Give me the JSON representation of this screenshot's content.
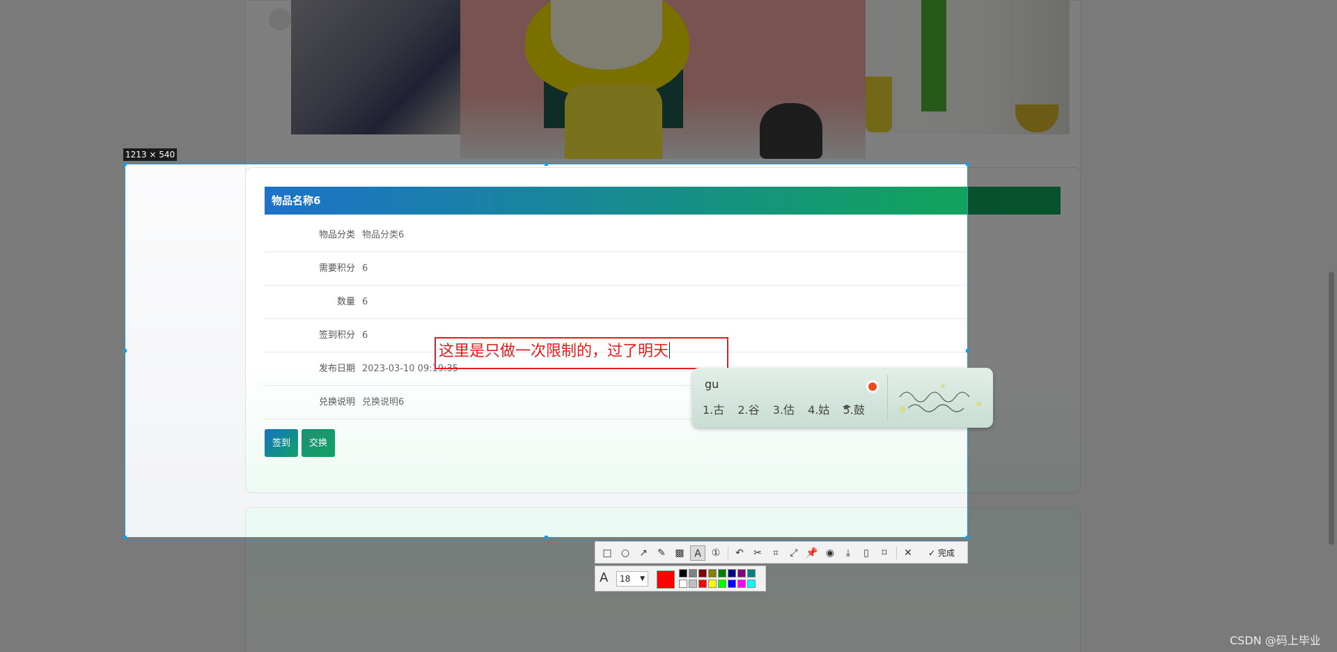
{
  "selection": {
    "size_label": "1213 × 540"
  },
  "item": {
    "title": "物品名称6",
    "rows": [
      {
        "label": "物品分类",
        "value": "物品分类6"
      },
      {
        "label": "需要积分",
        "value": "6"
      },
      {
        "label": "数量",
        "value": "6"
      },
      {
        "label": "签到积分",
        "value": "6"
      },
      {
        "label": "发布日期",
        "value": "2023-03-10 09:19:35"
      },
      {
        "label": "兑换说明",
        "value": "兑换说明6"
      }
    ],
    "sign_button": "签到",
    "exchange_button": "交换"
  },
  "annotation": {
    "text": "这里是只做一次限制的，过了明天",
    "color": "#e31b1b"
  },
  "ime": {
    "input": "gu",
    "candidates": [
      "1.古",
      "2.谷",
      "3.估",
      "4.姑",
      "5.鼓"
    ]
  },
  "toolbar": {
    "tools": [
      "rectangle-tool",
      "ellipse-tool",
      "arrow-tool",
      "pen-tool",
      "mosaic-tool",
      "text-tool",
      "number-tool",
      "undo-tool",
      "cut-tool",
      "ocr-tool",
      "scroll-capture-tool",
      "pin-tool",
      "record-tool",
      "save-tool",
      "phone-tool",
      "bookmark-tool",
      "close-tool"
    ],
    "done_label": "完成",
    "font_size": "18",
    "current_color": "#ff0000",
    "palette": [
      "#000000",
      "#808080",
      "#800000",
      "#808000",
      "#008000",
      "#000080",
      "#800080",
      "#008080",
      "#ffffff",
      "#c0c0c0",
      "#ff0000",
      "#ffff00",
      "#00ff00",
      "#0000ff",
      "#ff00ff",
      "#00ffff"
    ]
  },
  "watermark": "CSDN @码上毕业"
}
